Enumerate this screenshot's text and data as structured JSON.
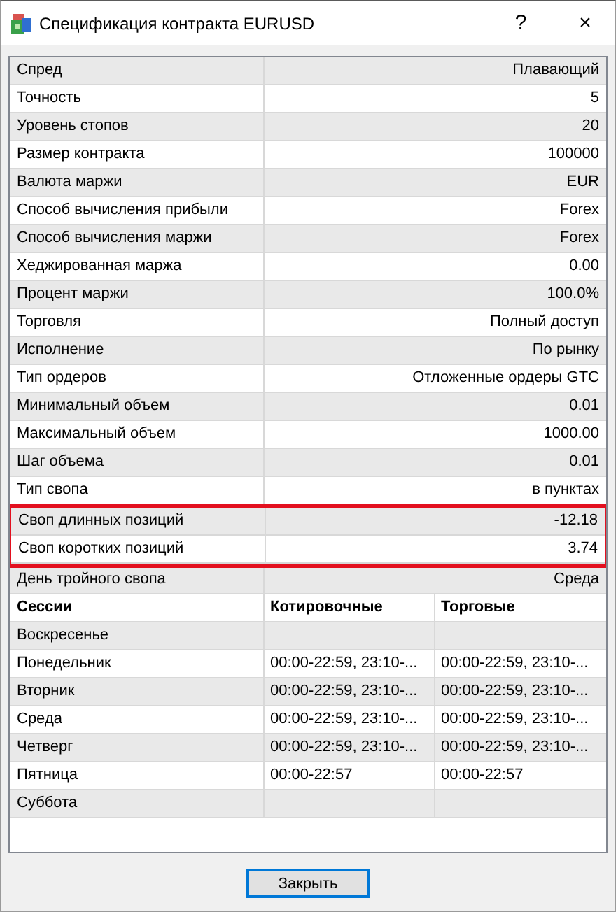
{
  "window": {
    "title": "Спецификация контракта EURUSD",
    "help": "?",
    "close": "×"
  },
  "properties": [
    {
      "label": "Спред",
      "value": "Плавающий",
      "highlighted": false
    },
    {
      "label": "Точность",
      "value": "5",
      "highlighted": false
    },
    {
      "label": "Уровень стопов",
      "value": "20",
      "highlighted": false
    },
    {
      "label": "Размер контракта",
      "value": "100000",
      "highlighted": false
    },
    {
      "label": "Валюта маржи",
      "value": "EUR",
      "highlighted": false
    },
    {
      "label": "Способ вычисления прибыли",
      "value": "Forex",
      "highlighted": false
    },
    {
      "label": "Способ вычисления маржи",
      "value": "Forex",
      "highlighted": false
    },
    {
      "label": "Хеджированная маржа",
      "value": "0.00",
      "highlighted": false
    },
    {
      "label": "Процент маржи",
      "value": "100.0%",
      "highlighted": false
    },
    {
      "label": "Торговля",
      "value": "Полный доступ",
      "highlighted": false
    },
    {
      "label": "Исполнение",
      "value": "По рынку",
      "highlighted": false
    },
    {
      "label": "Тип ордеров",
      "value": "Отложенные ордеры GTC",
      "highlighted": false
    },
    {
      "label": "Минимальный объем",
      "value": "0.01",
      "highlighted": false
    },
    {
      "label": "Максимальный объем",
      "value": "1000.00",
      "highlighted": false
    },
    {
      "label": "Шаг объема",
      "value": "0.01",
      "highlighted": false
    },
    {
      "label": "Тип свопа",
      "value": "в пунктах",
      "highlighted": false
    },
    {
      "label": "Своп длинных позиций",
      "value": "-12.18",
      "highlighted": true
    },
    {
      "label": "Своп коротких позиций",
      "value": "3.74",
      "highlighted": true
    },
    {
      "label": "День тройного свопа",
      "value": "Среда",
      "highlighted": false
    }
  ],
  "sessions": {
    "columns": [
      "Сессии",
      "Котировочные",
      "Торговые"
    ],
    "rows": [
      {
        "day": "Воскресенье"
      },
      {
        "day": "Понедельник",
        "quotes": "00:00-22:59, 23:10-...",
        "trades": "00:00-22:59, 23:10-..."
      },
      {
        "day": "Вторник",
        "quotes": "00:00-22:59, 23:10-...",
        "trades": "00:00-22:59, 23:10-..."
      },
      {
        "day": "Среда",
        "quotes": "00:00-22:59, 23:10-...",
        "trades": "00:00-22:59, 23:10-..."
      },
      {
        "day": "Четверг",
        "quotes": "00:00-22:59, 23:10-...",
        "trades": "00:00-22:59, 23:10-..."
      },
      {
        "day": "Пятница",
        "quotes": "00:00-22:57",
        "trades": "00:00-22:57"
      },
      {
        "day": "Суббота"
      }
    ]
  },
  "buttons": [
    "Закрыть"
  ]
}
